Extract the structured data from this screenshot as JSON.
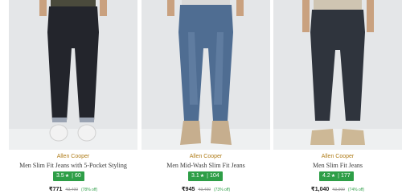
{
  "products": [
    {
      "brand": "Allen Cooper",
      "name": "Men Slim Fit Jeans with 5-Pocket Styling",
      "rating": "3.5",
      "rating_count": "60",
      "price": "₹771",
      "mrp": "₹3,499",
      "discount": "(78% off)",
      "colors": {
        "denim": "#23252c",
        "shoe": "#f2f2f2"
      }
    },
    {
      "brand": "Allen Cooper",
      "name": "Men Mid-Wash Slim Fit Jeans",
      "rating": "3.1",
      "rating_count": "104",
      "price": "₹945",
      "mrp": "₹3,499",
      "discount": "(73% off)",
      "colors": {
        "denim": "#4f6d92",
        "shoe": "#c6ae8e"
      }
    },
    {
      "brand": "Allen Cooper",
      "name": "Men Slim Fit Jeans",
      "rating": "4.2",
      "rating_count": "177",
      "price": "₹1,040",
      "mrp": "₹3,999",
      "discount": "(74% off)",
      "colors": {
        "denim": "#2f343d",
        "shoe": "#cdb896"
      }
    }
  ],
  "accent": {
    "rating_bg": "#2e9e47",
    "brand_text": "#b07d1a"
  },
  "icons": {
    "rating_star": "star-icon"
  }
}
